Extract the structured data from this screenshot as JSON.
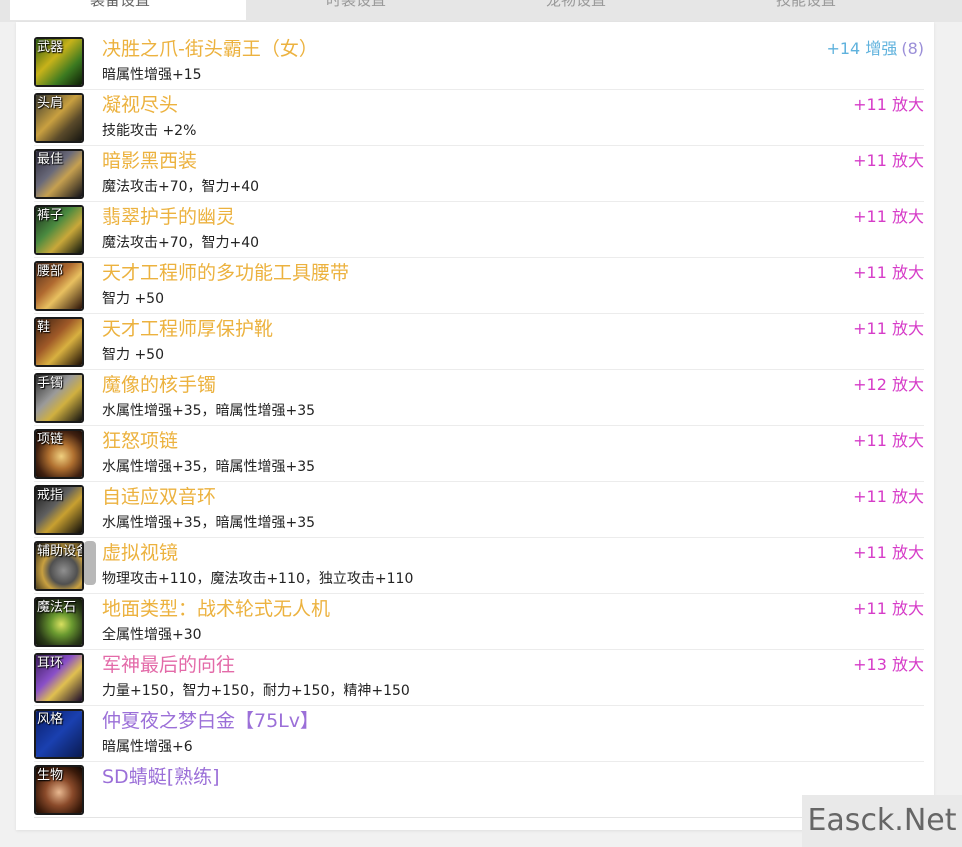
{
  "tabs": [
    "装备设置",
    "时装设置",
    "宠物设置",
    "技能设置"
  ],
  "equipment": [
    {
      "slot": "武器",
      "name": "决胜之爪-街头霸王（女）",
      "stat": "暗属性增强+15",
      "enh": "+14 增强",
      "enh_count": "(8)",
      "name_color": "#ecb23f",
      "enh_color": "#5fb2dd",
      "art": "linear-gradient(135deg,#2a5a10 0%,#c7b21a 40%,#3c7a20 70%,#0e1e06 100%)"
    },
    {
      "slot": "头肩",
      "name": "凝视尽头",
      "stat": "技能攻击 +2%",
      "enh": "+11 放大",
      "name_color": "#ecb23f",
      "enh_color": "#d63cc8",
      "art": "linear-gradient(135deg,#3a3a30 0%,#c9a040 45%,#5a4a2a 70%,#151510 100%)"
    },
    {
      "slot": "最佳",
      "name": "暗影黑西装",
      "stat": "魔法攻击+70，智力+40",
      "enh": "+11 放大",
      "name_color": "#ecb23f",
      "enh_color": "#d63cc8",
      "art": "linear-gradient(135deg,#2c2a3a 0%,#6a6a7a 40%,#c6a050 60%,#111118 100%)"
    },
    {
      "slot": "裤子",
      "name": "翡翠护手的幽灵",
      "stat": "魔法攻击+70，智力+40",
      "enh": "+11 放大",
      "name_color": "#ecb23f",
      "enh_color": "#d63cc8",
      "art": "linear-gradient(135deg,#1a2a1a 0%,#4a8a40 40%,#c9a83a 65%,#0c140c 100%)"
    },
    {
      "slot": "腰部",
      "name": "天才工程师的多功能工具腰带",
      "stat": "智力 +50",
      "enh": "+11 放大",
      "name_color": "#ecb23f",
      "enh_color": "#d63cc8",
      "art": "linear-gradient(135deg,#4a2a1a 0%,#b06a30 40%,#e8c060 60%,#2a1208 100%)"
    },
    {
      "slot": "鞋",
      "name": "天才工程师厚保护靴",
      "stat": "智力 +50",
      "enh": "+11 放大",
      "name_color": "#ecb23f",
      "enh_color": "#d63cc8",
      "art": "linear-gradient(135deg,#3a2010 0%,#a05a28 40%,#d8b040 62%,#1a0c04 100%)"
    },
    {
      "slot": "手镯",
      "name": "魔像的核手镯",
      "stat": "水属性增强+35，暗属性增强+35",
      "enh": "+12 放大",
      "name_color": "#ecb23f",
      "enh_color": "#d63cc8",
      "art": "linear-gradient(135deg,#2a2a2a 0%,#9a9a9a 40%,#d0b040 62%,#101010 100%)"
    },
    {
      "slot": "项链",
      "name": "狂怒项链",
      "stat": "水属性增强+35，暗属性增强+35",
      "enh": "+11 放大",
      "name_color": "#ecb23f",
      "enh_color": "#d63cc8",
      "art": "radial-gradient(circle at 55% 55%,#f0d080 0%,#b07030 35%,#402010 70%,#100804 100%)"
    },
    {
      "slot": "戒指",
      "name": "自适应双音环",
      "stat": "水属性增强+35，暗属性增强+35",
      "enh": "+11 放大",
      "name_color": "#ecb23f",
      "enh_color": "#d63cc8",
      "art": "linear-gradient(135deg,#181818 0%,#606060 40%,#c8a030 60%,#0a0a0a 100%)"
    },
    {
      "slot": "辅助设备",
      "name": "虚拟视镜",
      "stat": "物理攻击+110，魔法攻击+110，独立攻击+110",
      "enh": "+11 放大",
      "name_color": "#ecb23f",
      "enh_color": "#d63cc8",
      "art": "radial-gradient(circle at 60% 60%,#909090 0%,#505050 35%,#c8a040 55%,#101010 100%)"
    },
    {
      "slot": "魔法石",
      "name": "地面类型：战术轮式无人机",
      "stat": "全属性增强+30",
      "enh": "+11 放大",
      "name_color": "#ecb23f",
      "enh_color": "#d63cc8",
      "art": "radial-gradient(circle at 55% 55%,#d8e060 0%,#6a9a30 30%,#2a3a18 65%,#0a0c06 100%)"
    },
    {
      "slot": "耳环",
      "name": "军神最后的向往",
      "stat": "力量+150，智力+150，耐力+150，精神+150",
      "enh": "+13 放大",
      "name_color": "#e36aa8",
      "enh_color": "#d63cc8",
      "art": "linear-gradient(135deg,#3a1a5a 0%,#8a50c8 40%,#e0c050 62%,#1a0a2a 100%)"
    },
    {
      "slot": "风格",
      "name": "仲夏夜之梦白金【75Lv】",
      "stat": "暗属性增强+6",
      "enh": "",
      "name_color": "#9b6fd8",
      "enh_color": "#d63cc8",
      "art": "linear-gradient(135deg,#0a1e6a 0%,#1a40b0 50%,#0a1a50 100%)"
    },
    {
      "slot": "生物",
      "name": "SD蜻蜓[熟练]",
      "stat": "",
      "enh": "",
      "name_color": "#9b6fd8",
      "enh_color": "#d63cc8",
      "art": "radial-gradient(circle at 50% 55%,#e8b890 0%,#8a4a2a 40%,#3a1a0a 75%,#100804 100%)"
    }
  ],
  "watermark": "Easck.Net"
}
